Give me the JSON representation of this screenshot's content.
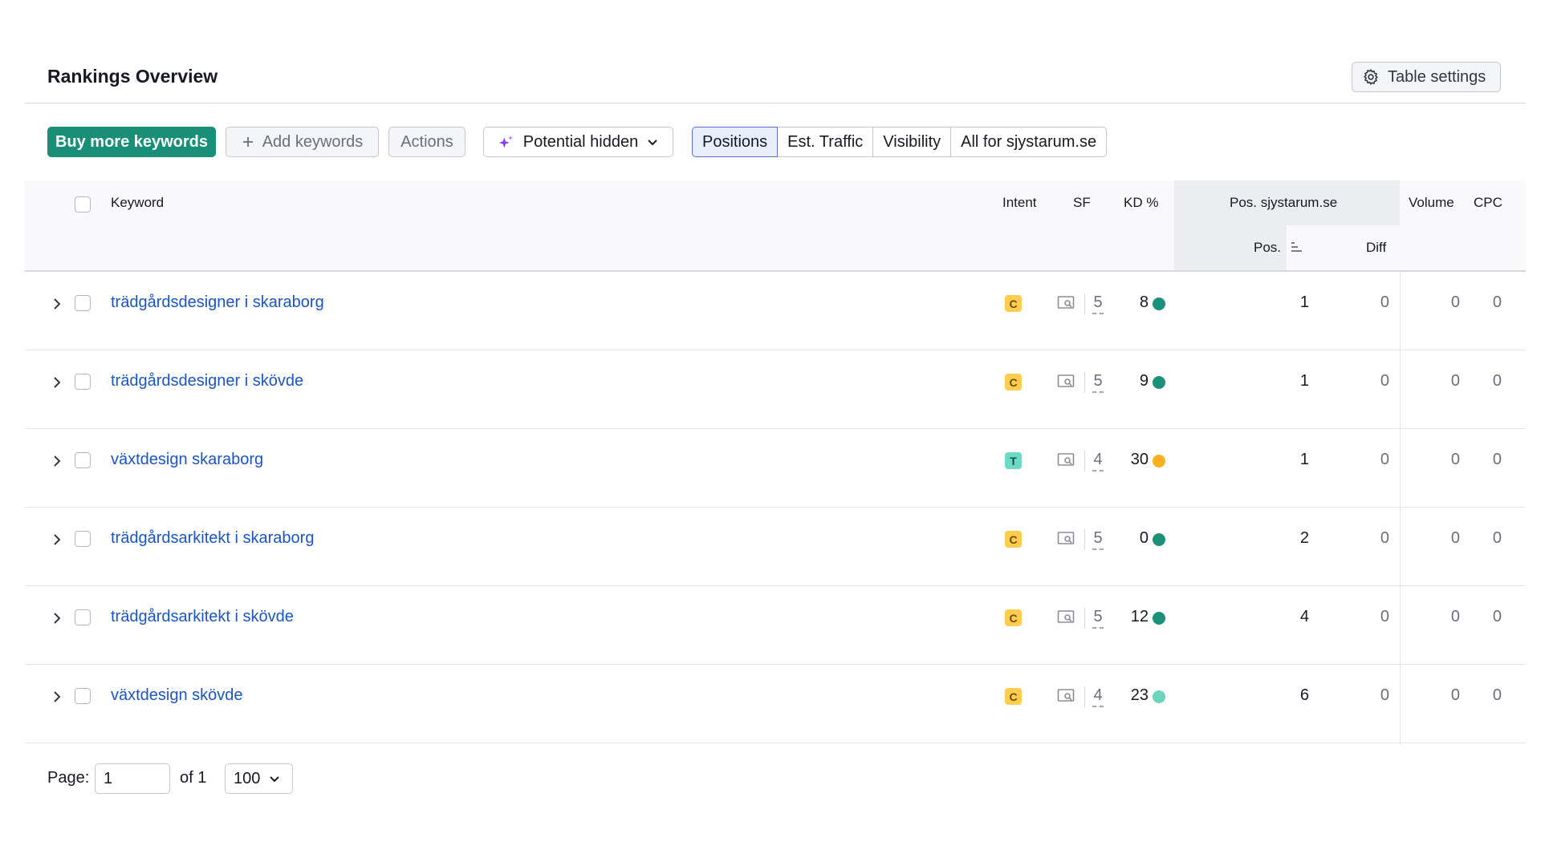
{
  "header": {
    "title": "Rankings Overview",
    "table_settings_label": "Table settings"
  },
  "toolbar": {
    "buy_more_label": "Buy more keywords",
    "add_keywords_label": "Add keywords",
    "actions_label": "Actions",
    "potential_label": "Potential hidden",
    "tabs": [
      {
        "label": "Positions",
        "active": true
      },
      {
        "label": "Est. Traffic",
        "active": false
      },
      {
        "label": "Visibility",
        "active": false
      },
      {
        "label": "All for sjystarum.se",
        "active": false
      }
    ]
  },
  "table": {
    "columns": {
      "keyword": "Keyword",
      "intent": "Intent",
      "sf": "SF",
      "kd": "KD %",
      "pos_group": "Pos. sjystarum.se",
      "pos": "Pos.",
      "diff": "Diff",
      "volume": "Volume",
      "cpc": "CPC"
    },
    "rows": [
      {
        "keyword": "trädgårdsdesigner i skaraborg",
        "intent": "C",
        "sf": "5",
        "kd": "8",
        "kd_color": "#1a9178",
        "pos": "1",
        "diff": "0",
        "volume": "0",
        "cpc": "0"
      },
      {
        "keyword": "trädgårdsdesigner i skövde",
        "intent": "C",
        "sf": "5",
        "kd": "9",
        "kd_color": "#1a9178",
        "pos": "1",
        "diff": "0",
        "volume": "0",
        "cpc": "0"
      },
      {
        "keyword": "växtdesign skaraborg",
        "intent": "T",
        "sf": "4",
        "kd": "30",
        "kd_color": "#ffb01f",
        "pos": "1",
        "diff": "0",
        "volume": "0",
        "cpc": "0"
      },
      {
        "keyword": "trädgårdsarkitekt i skaraborg",
        "intent": "C",
        "sf": "5",
        "kd": "0",
        "kd_color": "#1a9178",
        "pos": "2",
        "diff": "0",
        "volume": "0",
        "cpc": "0"
      },
      {
        "keyword": "trädgårdsarkitekt i skövde",
        "intent": "C",
        "sf": "5",
        "kd": "12",
        "kd_color": "#1a9178",
        "pos": "4",
        "diff": "0",
        "volume": "0",
        "cpc": "0"
      },
      {
        "keyword": "växtdesign skövde",
        "intent": "C",
        "sf": "4",
        "kd": "23",
        "kd_color": "#6cd3bd",
        "pos": "6",
        "diff": "0",
        "volume": "0",
        "cpc": "0"
      }
    ]
  },
  "pagination": {
    "page_label": "Page:",
    "page_value": "1",
    "of_label": "of 1",
    "per_page": "100"
  },
  "colors": {
    "primary": "#1a8f78",
    "link": "#1a55c4",
    "active_tab_border": "#5c6ed6"
  }
}
